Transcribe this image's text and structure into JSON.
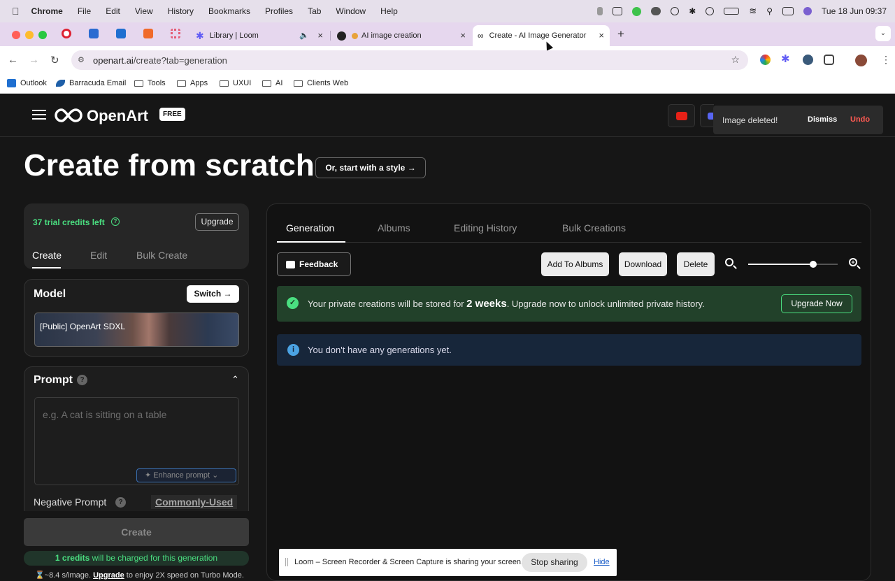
{
  "mac_menu": {
    "app": "Chrome",
    "items": [
      "File",
      "Edit",
      "View",
      "History",
      "Bookmarks",
      "Profiles",
      "Tab",
      "Window",
      "Help"
    ],
    "clock": "Tue 18 Jun  09:37"
  },
  "tabs": {
    "loom_label": "Library | Loom",
    "ai_label": "AI image creation",
    "active_label": "Create - AI Image Generator |",
    "new_tab": "+"
  },
  "address": {
    "url_host": "openart.ai",
    "url_path": "/create?tab=generation"
  },
  "bookmarks": [
    "Outlook",
    "Barracuda Email",
    "Tools",
    "Apps",
    "UXUI",
    "AI",
    "Clients Web"
  ],
  "topbar": {
    "logo": "OpenArt",
    "badge": "FREE"
  },
  "toast": {
    "message": "Image deleted!",
    "dismiss": "Dismiss",
    "undo": "Undo"
  },
  "page": {
    "title": "Create from scratch",
    "style_button": "Or, start with a style →"
  },
  "credits": {
    "text": "37 trial credits left",
    "upgrade": "Upgrade"
  },
  "side_tabs": [
    "Create",
    "Edit",
    "Bulk Create"
  ],
  "model": {
    "heading": "Model",
    "switch": "Switch",
    "name": "[Public] OpenArt SDXL"
  },
  "prompt": {
    "heading": "Prompt",
    "placeholder": "e.g. A cat is sitting on a table",
    "enhance": "Enhance prompt",
    "negative": "Negative Prompt",
    "commonly_used": "Commonly-Used"
  },
  "create": {
    "button": "Create",
    "credits_bold": "1 credits",
    "credits_rest": " will be charged for this generation",
    "speed_text": "~8.4 s/image.",
    "speed_upgrade": "Upgrade",
    "speed_rest": " to enjoy 2X speed on Turbo Mode."
  },
  "main_tabs": [
    "Generation",
    "Albums",
    "Editing History",
    "Bulk Creations"
  ],
  "toolbar": {
    "feedback": "Feedback",
    "add_albums": "Add To Albums",
    "download": "Download",
    "delete": "Delete",
    "zoom_level": 0.73
  },
  "banner": {
    "text1": "Your private creations will be stored for ",
    "bold": "2 weeks",
    "text2": ". Upgrade now to unlock unlimited private history.",
    "button": "Upgrade Now"
  },
  "info": {
    "text": "You don't have any generations yet."
  },
  "loom": {
    "text": "Loom – Screen Recorder & Screen Capture is sharing your screen.",
    "stop": "Stop sharing",
    "hide": "Hide"
  },
  "colors": {
    "accent_green": "#4ade80",
    "undo_red": "#ff5a52",
    "banner_bg": "#22412a",
    "info_bg": "#17263a"
  }
}
